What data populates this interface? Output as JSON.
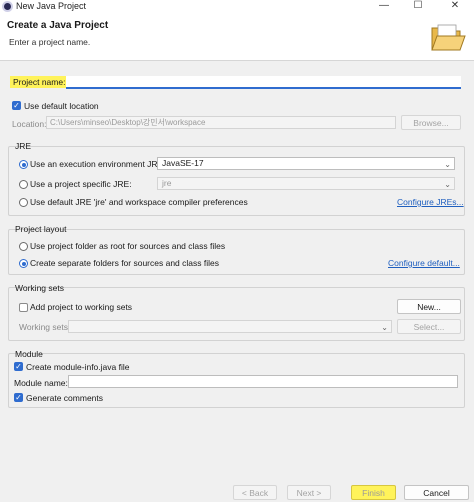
{
  "window": {
    "title": "New Java Project",
    "minimize": "—",
    "maximize": "☐",
    "close": "✕"
  },
  "header": {
    "title": "Create a Java Project",
    "subtitle": "Enter a project name."
  },
  "project_name": {
    "label": "Project name:",
    "value": ""
  },
  "location": {
    "use_default_label": "Use default location",
    "use_default_checked": true,
    "label": "Location:",
    "value": "C:\\Users\\minseo\\Desktop\\강민서\\workspace",
    "browse": "Browse..."
  },
  "jre": {
    "group_label": "JRE",
    "option_env_label": "Use an execution environment JRE:",
    "env_value": "JavaSE-17",
    "option_specific_label": "Use a project specific JRE:",
    "specific_value": "jre",
    "option_default_label": "Use default JRE 'jre' and workspace compiler preferences",
    "configure_link": "Configure JREs...",
    "selected": "env"
  },
  "layout": {
    "group_label": "Project layout",
    "option_root_label": "Use project folder as root for sources and class files",
    "option_separate_label": "Create separate folders for sources and class files",
    "configure_link": "Configure default...",
    "selected": "separate"
  },
  "working_sets": {
    "group_label": "Working sets",
    "add_label": "Add project to working sets",
    "add_checked": false,
    "new_button": "New...",
    "sets_label": "Working sets:",
    "select_button": "Select..."
  },
  "module": {
    "group_label": "Module",
    "create_label": "Create module-info.java file",
    "create_checked": true,
    "name_label": "Module name:",
    "name_value": "",
    "comments_label": "Generate comments",
    "comments_checked": true
  },
  "footer": {
    "back": "< Back",
    "next": "Next >",
    "finish": "Finish",
    "cancel": "Cancel"
  },
  "colors": {
    "accent": "#2f6ccf",
    "highlight": "#fff35a",
    "link": "#1f5fbf"
  },
  "icons": {
    "app": "eclipse-icon",
    "banner": "open-folder-icon",
    "check": "checkmark-icon",
    "dropdown": "chevron-down-icon"
  }
}
